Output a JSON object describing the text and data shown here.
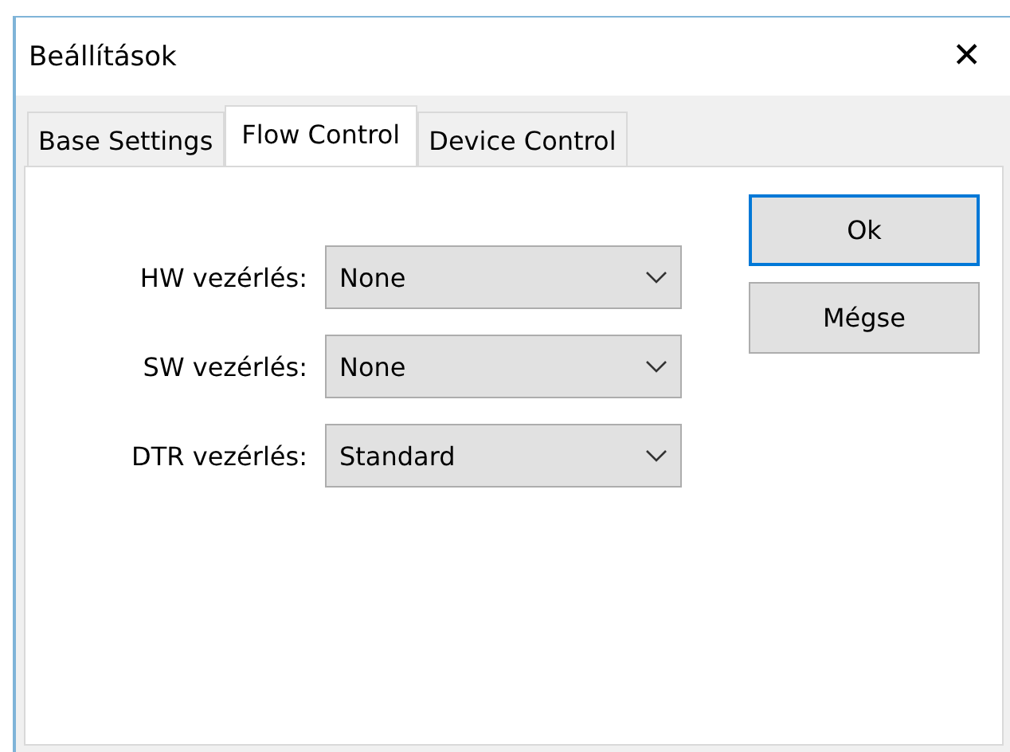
{
  "window": {
    "title": "Beállítások",
    "close_glyph": "✕"
  },
  "tabs": [
    {
      "label": "Base Settings",
      "selected": false
    },
    {
      "label": "Flow Control",
      "selected": true
    },
    {
      "label": "Device Control",
      "selected": false
    }
  ],
  "fields": [
    {
      "label": "HW vezérlés:",
      "value": "None"
    },
    {
      "label": "SW vezérlés:",
      "value": "None"
    },
    {
      "label": "DTR vezérlés:",
      "value": "Standard"
    }
  ],
  "buttons": [
    {
      "label": "Ok",
      "default": true
    },
    {
      "label": "Mégse",
      "default": false
    }
  ]
}
